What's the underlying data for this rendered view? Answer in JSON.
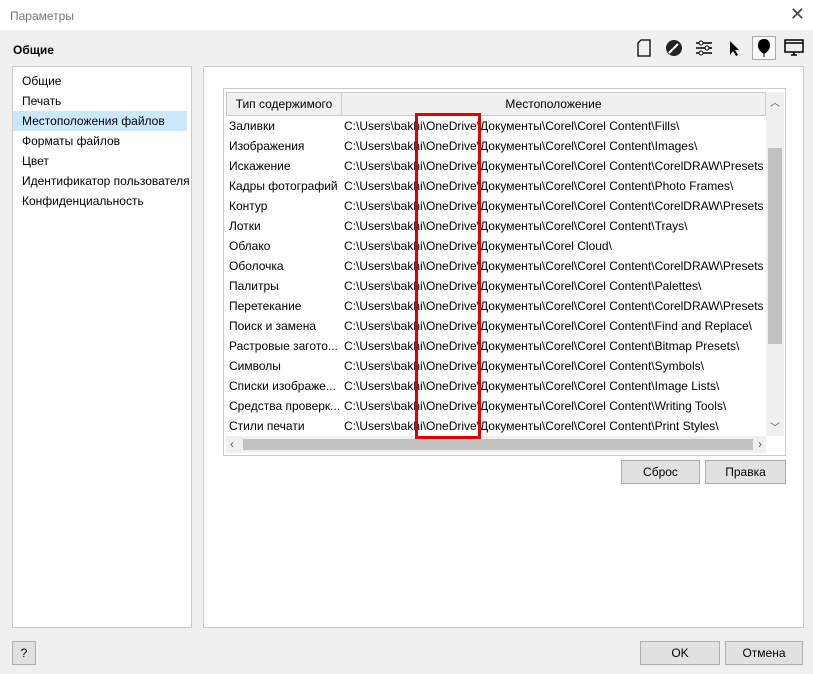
{
  "window": {
    "title": "Параметры",
    "section": "Общие"
  },
  "toolbar": {
    "icons": [
      "document-icon",
      "pen-icon",
      "sliders-icon",
      "cursor-icon",
      "balloon-icon",
      "monitor-icon"
    ]
  },
  "sidebar": {
    "items": [
      {
        "label": "Общие"
      },
      {
        "label": "Печать"
      },
      {
        "label": "Местоположения файлов",
        "selected": true
      },
      {
        "label": "Форматы файлов"
      },
      {
        "label": "Цвет"
      },
      {
        "label": "Идентификатор пользователя"
      },
      {
        "label": "Конфиденциальность"
      }
    ]
  },
  "table": {
    "headers": [
      "Тип содержимого",
      "Местоположение"
    ],
    "rows": [
      [
        "Заливки",
        "C:\\Users\\bakhi\\OneDrive\\Документы\\Corel\\Corel Content\\Fills\\"
      ],
      [
        "Изображения",
        "C:\\Users\\bakhi\\OneDrive\\Документы\\Corel\\Corel Content\\Images\\"
      ],
      [
        "Искажение",
        "C:\\Users\\bakhi\\OneDrive\\Документы\\Corel\\Corel Content\\CorelDRAW\\Presets"
      ],
      [
        "Кадры фотографий",
        "C:\\Users\\bakhi\\OneDrive\\Документы\\Corel\\Corel Content\\Photo Frames\\"
      ],
      [
        "Контур",
        "C:\\Users\\bakhi\\OneDrive\\Документы\\Corel\\Corel Content\\CorelDRAW\\Presets"
      ],
      [
        "Лотки",
        "C:\\Users\\bakhi\\OneDrive\\Документы\\Corel\\Corel Content\\Trays\\"
      ],
      [
        "Облако",
        "C:\\Users\\bakhi\\OneDrive\\Документы\\Corel Cloud\\"
      ],
      [
        "Оболочка",
        "C:\\Users\\bakhi\\OneDrive\\Документы\\Corel\\Corel Content\\CorelDRAW\\Presets"
      ],
      [
        "Палитры",
        "C:\\Users\\bakhi\\OneDrive\\Документы\\Corel\\Corel Content\\Palettes\\"
      ],
      [
        "Перетекание",
        "C:\\Users\\bakhi\\OneDrive\\Документы\\Corel\\Corel Content\\CorelDRAW\\Presets"
      ],
      [
        "Поиск и замена",
        "C:\\Users\\bakhi\\OneDrive\\Документы\\Corel\\Corel Content\\Find and Replace\\"
      ],
      [
        "Растровые загото...",
        "C:\\Users\\bakhi\\OneDrive\\Документы\\Corel\\Corel Content\\Bitmap Presets\\"
      ],
      [
        "Символы",
        "C:\\Users\\bakhi\\OneDrive\\Документы\\Corel\\Corel Content\\Symbols\\"
      ],
      [
        "Списки изображе...",
        "C:\\Users\\bakhi\\OneDrive\\Документы\\Corel\\Corel Content\\Image Lists\\"
      ],
      [
        "Средства проверк...",
        "C:\\Users\\bakhi\\OneDrive\\Документы\\Corel\\Corel Content\\Writing Tools\\"
      ],
      [
        "Стили печати",
        "C:\\Users\\bakhi\\OneDrive\\Документы\\Corel\\Corel Content\\Print Styles\\"
      ]
    ]
  },
  "buttons": {
    "reset": "Сброс",
    "edit": "Правка",
    "help": "?",
    "ok": "OK",
    "cancel": "Отмена"
  },
  "highlight_color": "#e00000"
}
